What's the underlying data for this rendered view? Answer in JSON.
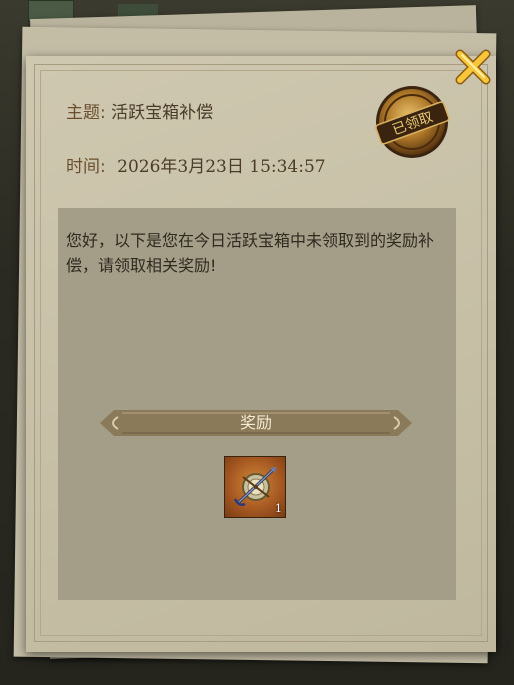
{
  "mail": {
    "subject_label": "主题:",
    "subject_value": "活跃宝箱补偿",
    "time_label": "时间:",
    "time_value": "2026年3月23日  15:34:57",
    "body": "您好，以下是您在今日活跃宝箱中未领取到的奖励补偿，请领取相关奖励!",
    "status_stamp": "已领取"
  },
  "rewards": {
    "banner_label": "奖励",
    "items": [
      {
        "icon": "compass-crossbow-icon",
        "count": "1"
      }
    ]
  },
  "colors": {
    "paper": "#c9c2a9",
    "panel": "#a49e88",
    "banner": "#8a7a5a",
    "text": "#2f2a20",
    "close_x": "#f2b52a"
  },
  "icons": {
    "close": "close-x-icon",
    "stamp": "claimed-seal-icon"
  }
}
